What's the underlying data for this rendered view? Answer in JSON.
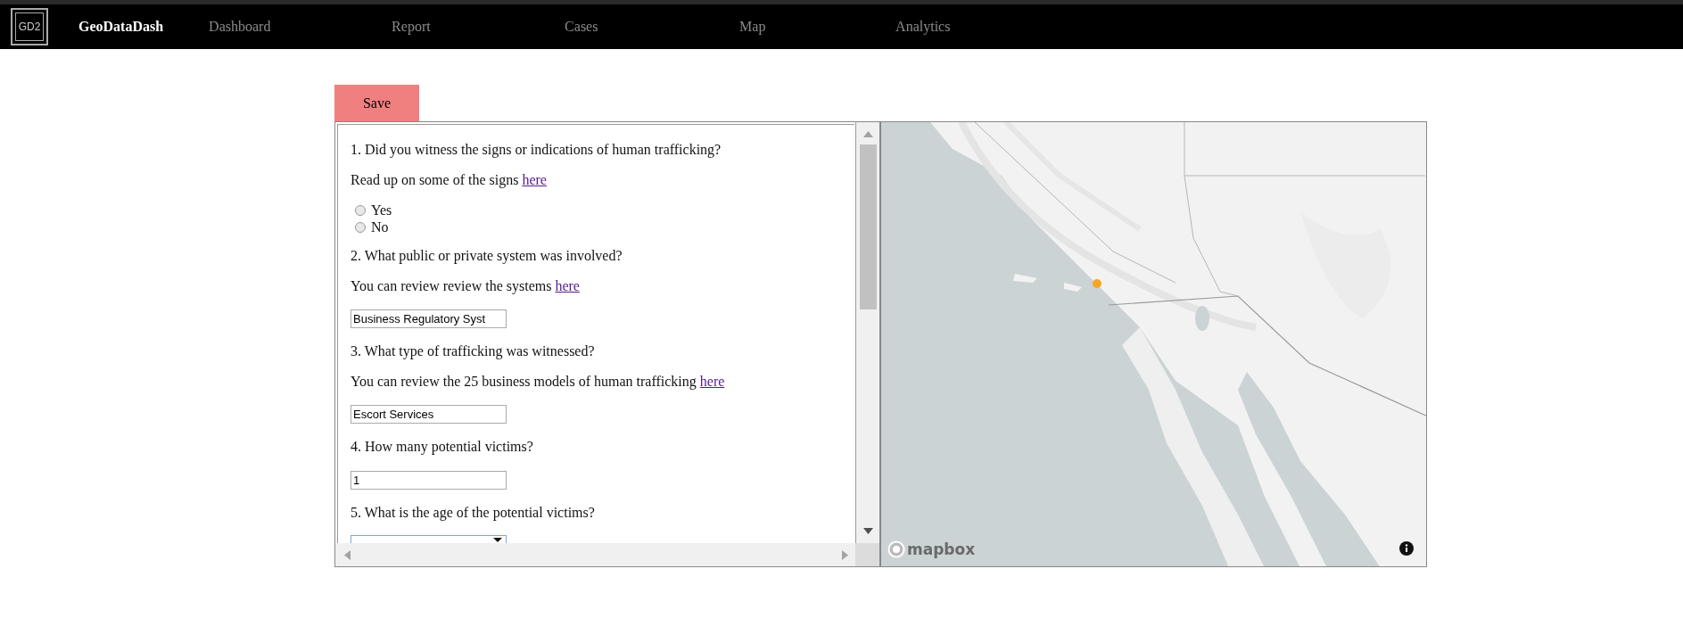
{
  "navbar": {
    "logo": "GD2",
    "brand": "GeoDataDash",
    "links": [
      {
        "label": "Dashboard"
      },
      {
        "label": "Report"
      },
      {
        "label": "Cases"
      },
      {
        "label": "Map"
      },
      {
        "label": "Analytics"
      }
    ]
  },
  "save_button": "Save",
  "form": {
    "items": [
      {
        "kind": "question",
        "text": "1. Did you witness the signs or indications of human trafficking?"
      },
      {
        "kind": "note",
        "text": "Read up on some of the signs ",
        "link": "here"
      },
      {
        "kind": "radios",
        "options": [
          {
            "label": "Yes",
            "selected": false
          },
          {
            "label": "No",
            "selected": false
          }
        ]
      },
      {
        "kind": "question",
        "text": "2. What public or private system was involved?"
      },
      {
        "kind": "note",
        "text": "You can review review the systems ",
        "link": "here"
      },
      {
        "kind": "input",
        "value": "Business Regulatory Syst"
      },
      {
        "kind": "question",
        "text": "3. What type of trafficking was witnessed?"
      },
      {
        "kind": "note",
        "text": "You can review the 25 business models of human trafficking ",
        "link": "here"
      },
      {
        "kind": "input",
        "value": "Escort Services"
      },
      {
        "kind": "question",
        "text": "4. How many potential victims?"
      },
      {
        "kind": "input",
        "value": "1"
      },
      {
        "kind": "question",
        "text": "5. What is the age of the potential victims?"
      },
      {
        "kind": "select"
      }
    ]
  },
  "map": {
    "attribution": "mapbox"
  }
}
